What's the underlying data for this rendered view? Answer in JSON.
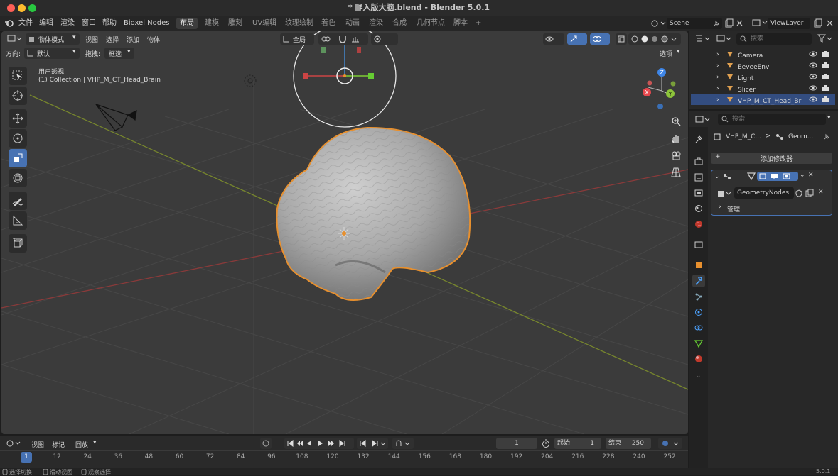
{
  "window": {
    "title": "* 导入版大脑.blend - Blender 5.0.1",
    "colors": {
      "close": "#fe5f57",
      "minimize": "#febc2e",
      "maximize": "#28c840"
    }
  },
  "menubar": {
    "items": [
      "文件",
      "编辑",
      "渲染",
      "窗口",
      "帮助",
      "Bioxel Nodes"
    ],
    "workspaces": [
      "布局",
      "建模",
      "雕刻",
      "UV编辑",
      "纹理绘制",
      "着色",
      "动画",
      "渲染",
      "合成",
      "几何节点",
      "脚本"
    ],
    "active_workspace": "布局",
    "add_tab": "+",
    "scene": "Scene",
    "view_layer": "ViewLayer"
  },
  "viewport": {
    "mode": "物体模式",
    "menus": [
      "视图",
      "选择",
      "添加",
      "物体"
    ],
    "orientation_label": "方向:",
    "orientation_value": "默认",
    "drag_label": "拖拽:",
    "drag_value": "框选",
    "transform_space": "全局",
    "options": "选项",
    "info_line1": "用户透视",
    "info_line2": "(1) Collection | VHP_M_CT_Head_Brain",
    "gizmo_axes": {
      "x": "X",
      "y": "Y",
      "z": "Z"
    },
    "accent": "#4772b3",
    "selection_outline": "#e8902e"
  },
  "tools": [
    "select-box-icon",
    "cursor-icon",
    "move-icon",
    "rotate-icon",
    "scale-icon",
    "transform-icon",
    "annotate-icon",
    "measure-icon",
    "add-cube-icon"
  ],
  "timeline": {
    "menus": [
      "视图",
      "标记",
      "回放"
    ],
    "current_frame": "1",
    "start_label": "起始",
    "start_value": "1",
    "end_label": "结束",
    "end_value": "250",
    "ticks": [
      "1",
      "12",
      "24",
      "36",
      "48",
      "60",
      "72",
      "84",
      "96",
      "108",
      "120",
      "132",
      "144",
      "156",
      "168",
      "180",
      "192",
      "204",
      "216",
      "228",
      "240",
      "252"
    ]
  },
  "statusbar": {
    "items": [
      "选择切换",
      "滑动视图",
      "观察选择"
    ],
    "version": "5.0.1"
  },
  "outliner": {
    "search_placeholder": "搜索",
    "items": [
      {
        "name": "Camera",
        "icon": "camera-icon",
        "color": "#e0a050"
      },
      {
        "name": "EeveeEnv",
        "icon": "light-probe-icon",
        "color": "#e0a050"
      },
      {
        "name": "Light",
        "icon": "light-icon",
        "color": "#e0a050"
      },
      {
        "name": "Slicer",
        "icon": "mesh-icon",
        "color": "#e0a050"
      },
      {
        "name": "VHP_M_CT_Head_Br",
        "icon": "mesh-icon",
        "color": "#e0a050",
        "selected": true
      }
    ]
  },
  "properties": {
    "search_placeholder": "搜索",
    "breadcrumb_object": "VHP_M_C...",
    "breadcrumb_separator": ">",
    "breadcrumb_modifier": "Geom...",
    "add_modifier": "添加修改器",
    "modifier_name": "GeometryNodes",
    "manage_label": "管理"
  }
}
